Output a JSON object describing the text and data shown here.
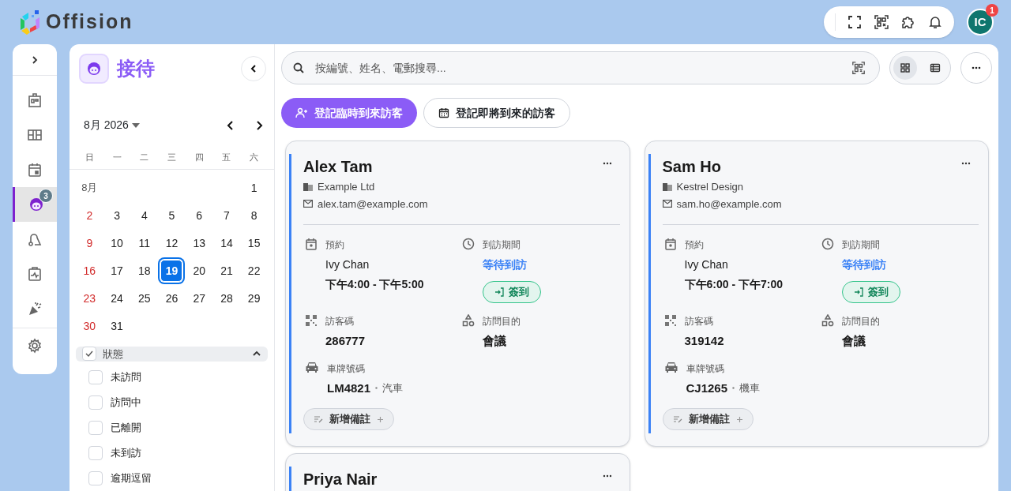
{
  "header": {
    "logo_text": "Offision",
    "avatar": "IC",
    "notification_count": "1"
  },
  "rail": [
    {
      "kind": "building",
      "selected": false
    },
    {
      "kind": "floorplan",
      "selected": false
    },
    {
      "kind": "calendar",
      "selected": false
    },
    {
      "kind": "visitor",
      "selected": true,
      "badge": "3"
    },
    {
      "kind": "cleaning",
      "selected": false
    },
    {
      "kind": "health",
      "selected": false
    },
    {
      "kind": "party",
      "selected": false
    },
    {
      "kind": "settings",
      "selected": false
    }
  ],
  "panel": {
    "title": "接待",
    "calendar": {
      "month_label": "8月 2026",
      "weekdays": [
        "日",
        "一",
        "二",
        "三",
        "四",
        "五",
        "六"
      ],
      "month_short": "8月",
      "weeks": [
        [
          {
            "day": "1",
            "selected": false
          }
        ],
        [
          {
            "day": "2",
            "selected": false
          },
          {
            "day": "3",
            "selected": false
          },
          {
            "day": "4",
            "selected": false
          },
          {
            "day": "5",
            "selected": false
          },
          {
            "day": "6",
            "selected": false
          },
          {
            "day": "7",
            "selected": false
          },
          {
            "day": "8",
            "selected": false
          }
        ],
        [
          {
            "day": "9",
            "selected": false
          },
          {
            "day": "10",
            "selected": false
          },
          {
            "day": "11",
            "selected": false
          },
          {
            "day": "12",
            "selected": false
          },
          {
            "day": "13",
            "selected": false
          },
          {
            "day": "14",
            "selected": false
          },
          {
            "day": "15",
            "selected": false
          }
        ],
        [
          {
            "day": "16",
            "selected": false
          },
          {
            "day": "17",
            "selected": false
          },
          {
            "day": "18",
            "selected": false
          },
          {
            "day": "19",
            "selected": true
          },
          {
            "day": "20",
            "selected": false
          },
          {
            "day": "21",
            "selected": false
          },
          {
            "day": "22",
            "selected": false
          }
        ],
        [
          {
            "day": "23",
            "selected": false
          },
          {
            "day": "24",
            "selected": false
          },
          {
            "day": "25",
            "selected": false
          },
          {
            "day": "26",
            "selected": false
          },
          {
            "day": "27",
            "selected": false
          },
          {
            "day": "28",
            "selected": false
          },
          {
            "day": "29",
            "selected": false
          }
        ],
        [
          {
            "day": "30",
            "selected": false
          },
          {
            "day": "31",
            "selected": false
          }
        ]
      ]
    },
    "filter": {
      "label": "狀態",
      "checked": true,
      "expanded": true,
      "options": [
        {
          "label": "未訪問",
          "checked": false
        },
        {
          "label": "訪問中",
          "checked": false
        },
        {
          "label": "已離開",
          "checked": false
        },
        {
          "label": "未到訪",
          "checked": false
        },
        {
          "label": "逾期逗留",
          "checked": false
        }
      ]
    }
  },
  "search": {
    "placeholder": "按編號、姓名、電郵搜尋..."
  },
  "views": [
    {
      "kind": "grid",
      "selected": true
    },
    {
      "kind": "list",
      "selected": false
    }
  ],
  "actions": {
    "primary": "登記臨時到來訪客",
    "secondary": "登記即將到來的訪客"
  },
  "cards": [
    {
      "name": "Alex Tam",
      "company": "Example Ltd",
      "email": "alex.tam@example.com",
      "booking_label": "預約",
      "host": "Ivy Chan",
      "time": "下午4:00 - 下午5:00",
      "period_label": "到訪期間",
      "status": "等待到訪",
      "checkin_button": "簽到",
      "code_label": "訪客碼",
      "code": "286777",
      "purpose_label": "訪問目的",
      "purpose": "會議",
      "plate_label": "車牌號碼",
      "plate": "LM4821",
      "vehicle": "汽車",
      "note_button": "新增備註"
    },
    {
      "name": "Sam Ho",
      "company": "Kestrel Design",
      "email": "sam.ho@example.com",
      "booking_label": "預約",
      "host": "Ivy Chan",
      "time": "下午6:00 - 下午7:00",
      "period_label": "到訪期間",
      "status": "等待到訪",
      "checkin_button": "簽到",
      "code_label": "訪客碼",
      "code": "319142",
      "purpose_label": "訪問目的",
      "purpose": "會議",
      "plate_label": "車牌號碼",
      "plate": "CJ1265",
      "vehicle": "機車",
      "note_button": "新增備註"
    },
    {
      "name": "Priya Nair"
    }
  ]
}
